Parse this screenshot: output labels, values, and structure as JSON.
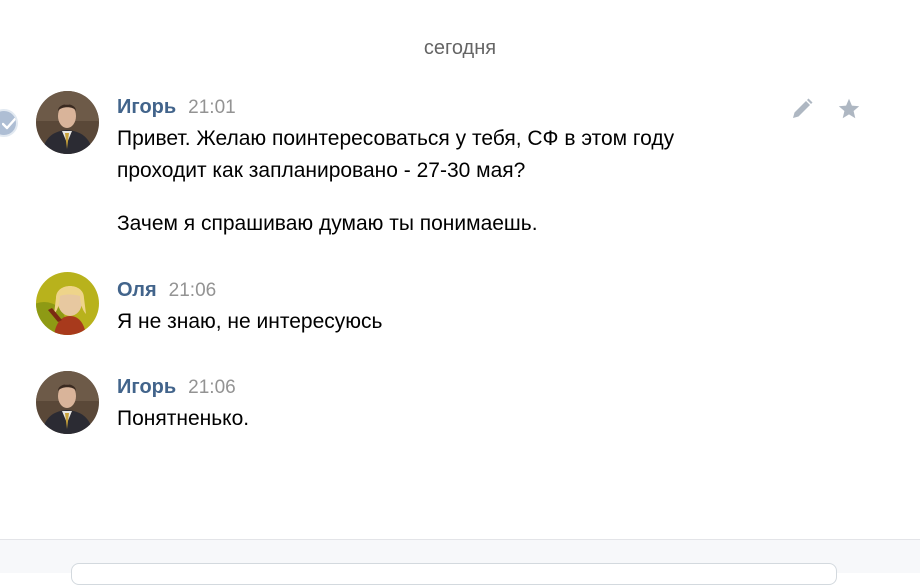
{
  "date_separator": "сегодня",
  "messages": [
    {
      "author": "Игорь",
      "time": "21:01",
      "lines": [
        "Привет. Желаю поинтересоваться у тебя, СФ в этом году",
        "проходит как запланировано - 27-30 мая?",
        "Зачем я спрашиваю думаю ты понимаешь."
      ]
    },
    {
      "author": "Оля",
      "time": "21:06",
      "lines": [
        "Я не знаю, не интересуюсь"
      ]
    },
    {
      "author": "Игорь",
      "time": "21:06",
      "lines": [
        "Понятненько."
      ]
    }
  ],
  "actions": {
    "edit_icon": "pencil-icon",
    "favorite_icon": "star-icon"
  },
  "colors": {
    "author": "#42648b",
    "time": "#939393",
    "separator": "#656565",
    "icons": "#aeb7c2"
  }
}
